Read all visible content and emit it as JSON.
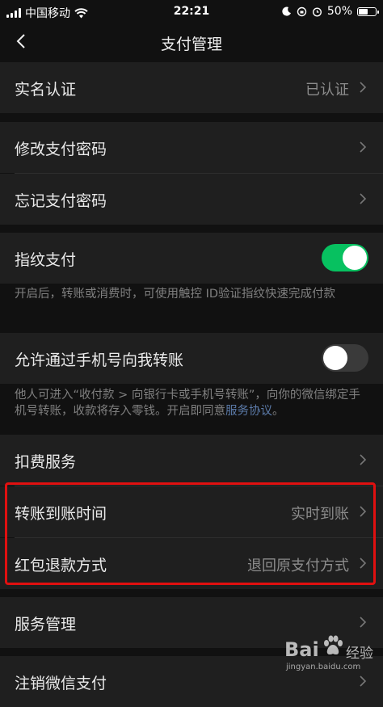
{
  "status_bar": {
    "carrier": "中国移动",
    "time": "22:21",
    "battery": "50%"
  },
  "nav": {
    "title": "支付管理"
  },
  "rows": {
    "real_name": {
      "label": "实名认证",
      "value": "已认证"
    },
    "change_password": {
      "label": "修改支付密码"
    },
    "forgot_password": {
      "label": "忘记支付密码"
    },
    "fingerprint": {
      "label": "指纹支付",
      "enabled": true
    },
    "phone_transfer": {
      "label": "允许通过手机号向我转账",
      "enabled": false
    },
    "deduction": {
      "label": "扣费服务"
    },
    "transfer_time": {
      "label": "转账到账时间",
      "value": "实时到账"
    },
    "refund_method": {
      "label": "红包退款方式",
      "value": "退回原支付方式"
    },
    "service_manage": {
      "label": "服务管理"
    },
    "close_pay": {
      "label": "注销微信支付"
    }
  },
  "tips": {
    "fingerprint": "开启后，转账或消费时，可使用触控 ID验证指纹快速完成付款",
    "phone_transfer_prefix": "他人可进入“收付款 > 向银行卡或手机号转账”，向你的微信绑定手机号转账，收款将存入零钱。开启即同意",
    "phone_transfer_link": "服务协议",
    "phone_transfer_suffix": "。"
  },
  "watermark": {
    "brand": "Bai",
    "brand_cn": "经验",
    "url": "jingyan.baidu.com"
  },
  "colors": {
    "background": "#111111",
    "cell": "#1f1f1f",
    "toggle_on": "#07c160",
    "link": "#5b7aa8",
    "highlight": "#e01010"
  }
}
